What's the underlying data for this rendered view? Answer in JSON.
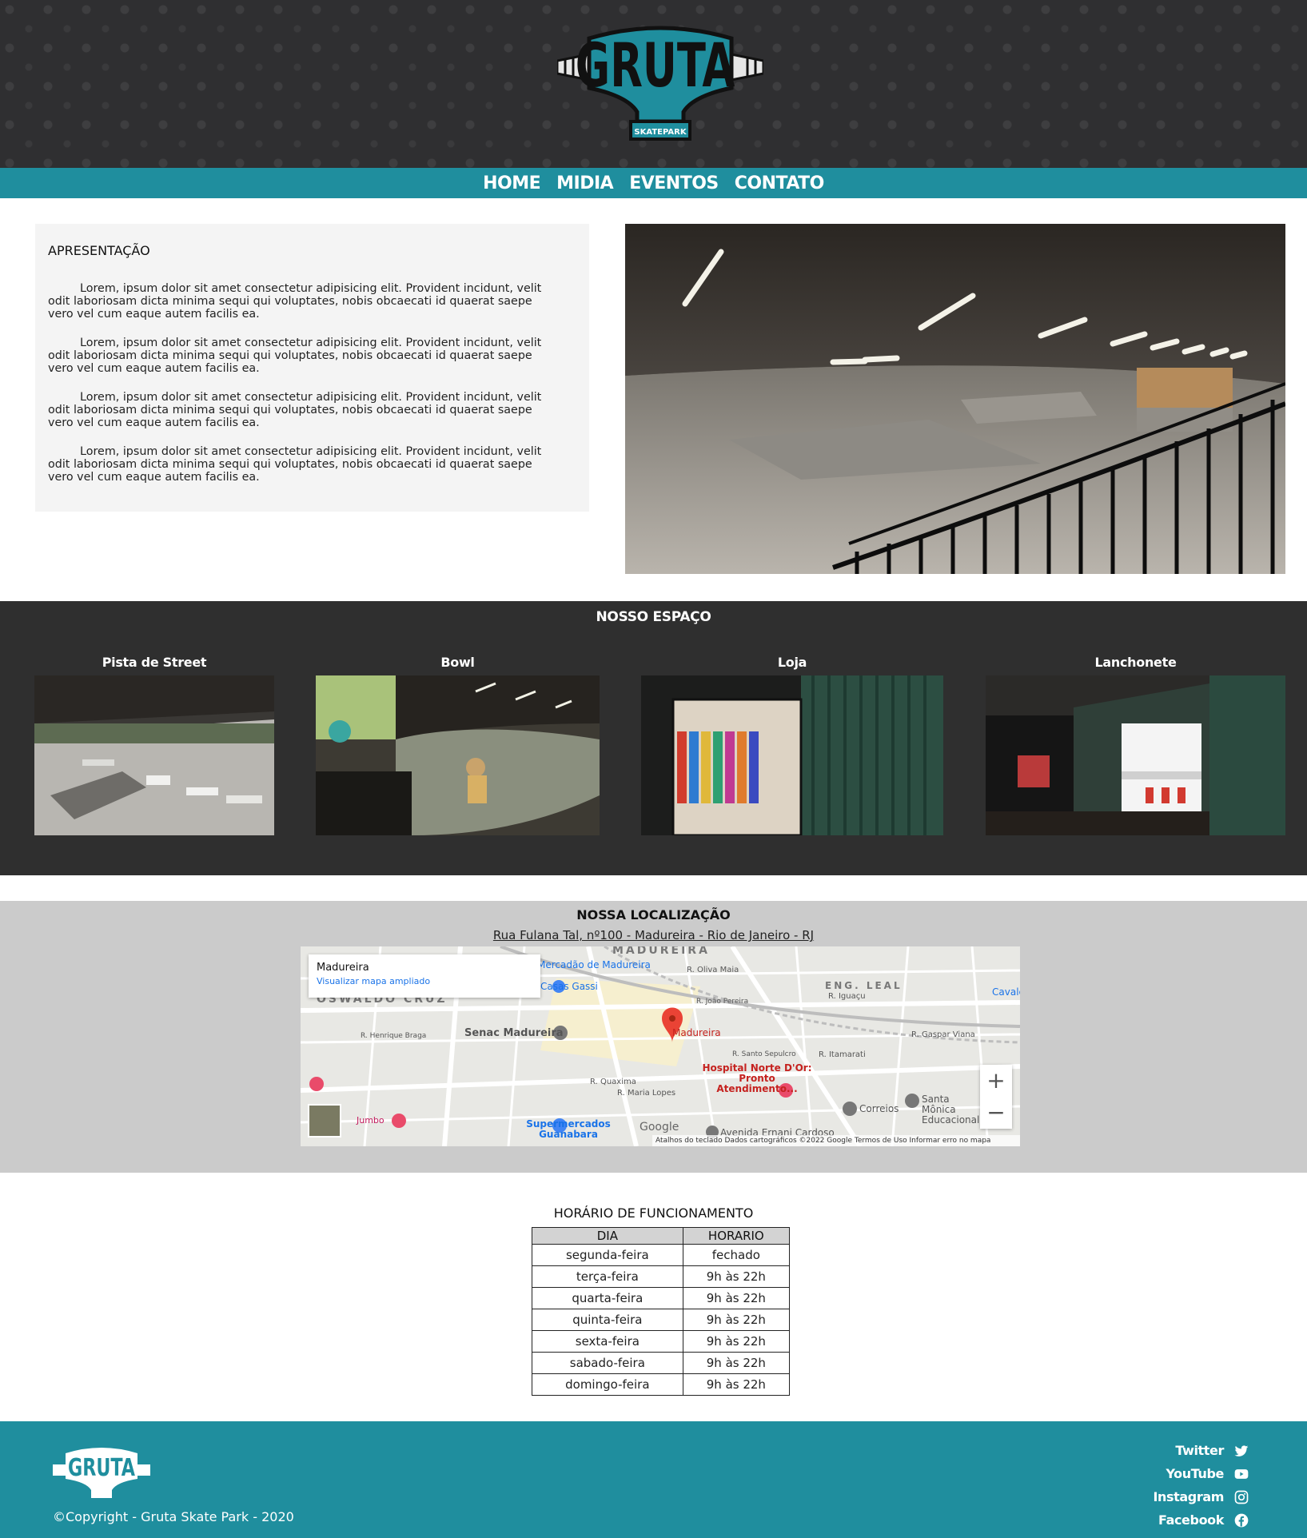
{
  "header": {
    "logo_text": "GRUTA",
    "logo_subtext": "SKATEPARK"
  },
  "nav": {
    "items": [
      "HOME",
      "MIDIA",
      "EVENTOS",
      "CONTATO"
    ]
  },
  "apresentacao": {
    "title": "APRESENTAÇÃO",
    "paragraphs": [
      "Lorem, ipsum dolor sit amet consectetur adipisicing elit. Provident incidunt, velit odit laboriosam dicta minima sequi qui voluptates, nobis obcaecati id quaerat saepe vero vel cum eaque autem facilis ea.",
      "Lorem, ipsum dolor sit amet consectetur adipisicing elit. Provident incidunt, velit odit laboriosam dicta minima sequi qui voluptates, nobis obcaecati id quaerat saepe vero vel cum eaque autem facilis ea.",
      "Lorem, ipsum dolor sit amet consectetur adipisicing elit. Provident incidunt, velit odit laboriosam dicta minima sequi qui voluptates, nobis obcaecati id quaerat saepe vero vel cum eaque autem facilis ea.",
      "Lorem, ipsum dolor sit amet consectetur adipisicing elit. Provident incidunt, velit odit laboriosam dicta minima sequi qui voluptates, nobis obcaecati id quaerat saepe vero vel cum eaque autem facilis ea."
    ]
  },
  "espaco": {
    "title": "NOSSO ESPAÇO",
    "cards": [
      "Pista de Street",
      "Bowl",
      "Loja",
      "Lanchonete"
    ]
  },
  "localizacao": {
    "title": "NOSSA LOCALIZAÇÃO",
    "address": "Rua Fulana Tal, nº100 - Madureira - Rio de Janeiro - RJ",
    "map": {
      "place_name": "Madureira",
      "view_larger": "Visualizar mapa ampliado",
      "zoom_in": "+",
      "zoom_out": "−",
      "footer_text": "Atalhos do teclado   Dados cartográficos ©2022 Google   Termos de Uso   Informar erro no mapa",
      "google": "Google",
      "labels": {
        "madureira_top": "MADUREIRA",
        "oswaldo": "OSWALDO CRUZ",
        "eng_leal": "ENG. LEAL",
        "mercadao": "Mercadão de Madureira",
        "casas": "Casas Gassi",
        "senac": "Senac Madureira",
        "pin": "Madureira",
        "hospital": "Hospital Norte D'Or: Pronto Atendimento...",
        "jumbo": "Jumbo",
        "supermercados": "Supermercados Guanabara",
        "correios": "Correios",
        "santa_monica": "Santa Mônica Educacional",
        "avenida": "Avenida Ernani Cardoso",
        "r_quaxima": "R. Quaxima",
        "r_maria_lopes": "R. Maria Lopes",
        "r_itamarati": "R. Itamarati",
        "r_gaspar": "R. Gaspar Viana",
        "r_iguacu": "R. Iguaçu",
        "r_oliva": "R. Oliva Maia",
        "r_joao": "R. João Pereira",
        "r_henrique": "R. Henrique Braga",
        "r_santo": "R. Santo Sepulcro",
        "cavalcanti": "Cavalcanti"
      }
    }
  },
  "horario": {
    "title": "HORÁRIO DE FUNCIONAMENTO",
    "headers": [
      "DIA",
      "HORARIO"
    ],
    "rows": [
      [
        "segunda-feira",
        "fechado"
      ],
      [
        "terça-feira",
        "9h às 22h"
      ],
      [
        "quarta-feira",
        "9h às 22h"
      ],
      [
        "quinta-feira",
        "9h às 22h"
      ],
      [
        "sexta-feira",
        "9h às 22h"
      ],
      [
        "sabado-feira",
        "9h às 22h"
      ],
      [
        "domingo-feira",
        "9h às 22h"
      ]
    ]
  },
  "footer": {
    "logo_text": "GRUTA",
    "copyright": "©Copyright - Gruta Skate Park - 2020",
    "social": [
      {
        "label": "Twitter",
        "icon": "twitter-icon"
      },
      {
        "label": "YouTube",
        "icon": "youtube-icon"
      },
      {
        "label": "Instagram",
        "icon": "instagram-icon"
      },
      {
        "label": "Facebook",
        "icon": "facebook-icon"
      }
    ]
  },
  "colors": {
    "header_bg": "#2f2f31",
    "teal": "#1f8e9e",
    "section_dark": "#2f2f2f",
    "section_grey": "#cbcbcb"
  }
}
